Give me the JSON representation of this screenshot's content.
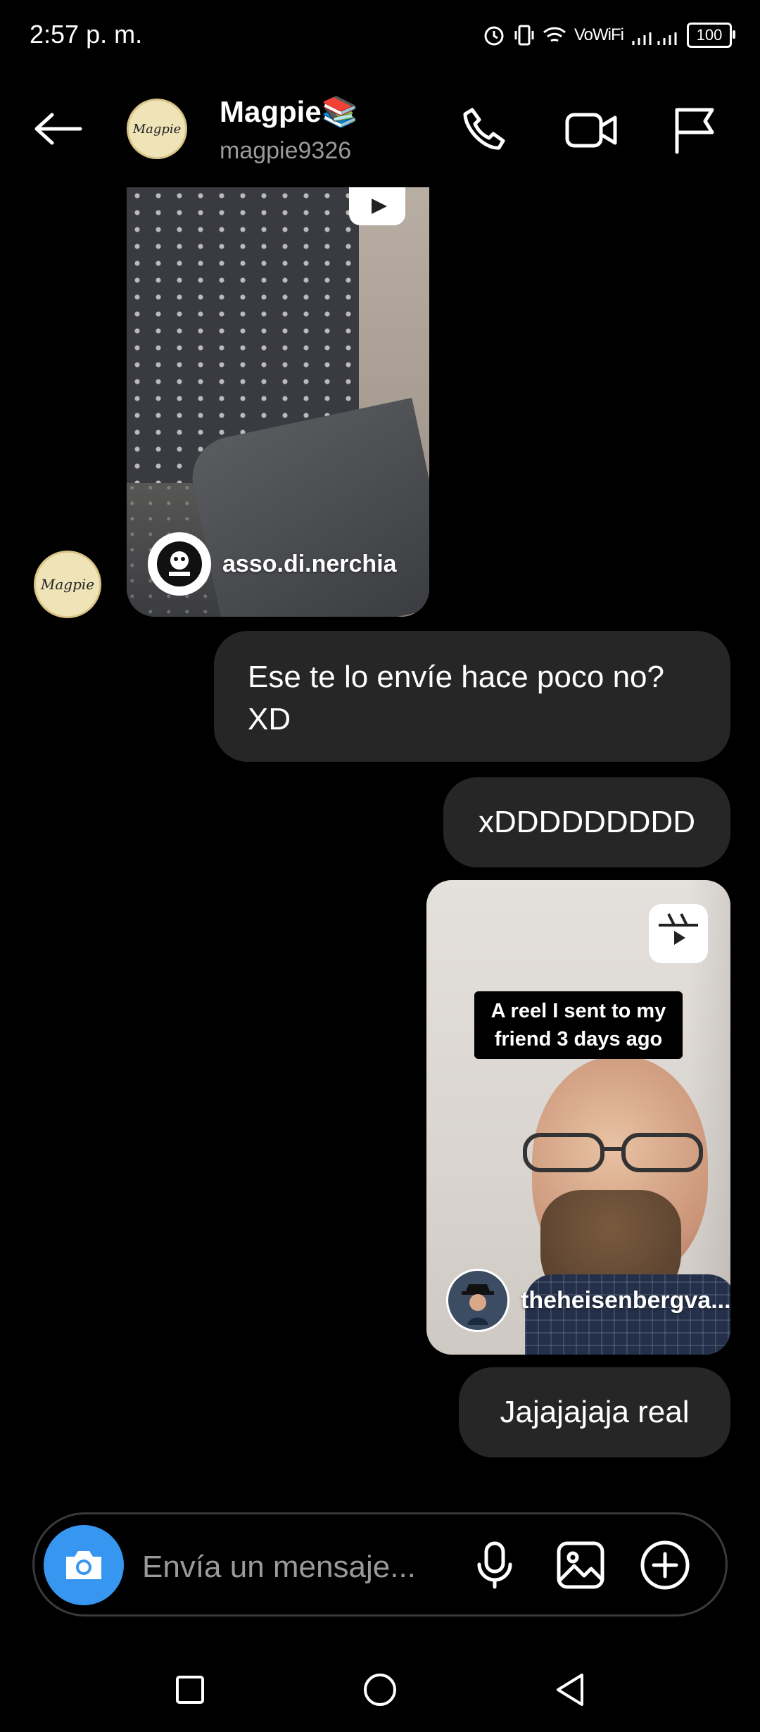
{
  "status_bar": {
    "time": "2:57 p. m.",
    "network_label": "VoWiFi",
    "battery": "100"
  },
  "header": {
    "name": "Magpie📚",
    "username": "magpie9326",
    "avatar_text": "Magpie"
  },
  "messages": [
    {
      "type": "reel",
      "side": "received",
      "author": "asso.di.nerchia"
    },
    {
      "type": "text",
      "side": "sent",
      "text": "Ese te lo envíe hace poco no? XD"
    },
    {
      "type": "text",
      "side": "sent",
      "text": "xDDDDDDDDD"
    },
    {
      "type": "reel",
      "side": "sent",
      "caption": "A reel I sent to my friend 3 days ago",
      "author": "theheisenbergva..."
    },
    {
      "type": "text",
      "side": "sent",
      "text": "Jajajajaja real"
    }
  ],
  "composer": {
    "placeholder": "Envía un mensaje..."
  },
  "colors": {
    "background": "#000000",
    "bubble": "#262626",
    "accent": "#3797f0"
  },
  "icons": {
    "back": "arrow-left-icon",
    "call": "phone-icon",
    "video": "video-camera-icon",
    "report": "flag-icon",
    "camera": "camera-icon",
    "mic": "microphone-icon",
    "gallery": "image-icon",
    "more": "plus-circle-icon",
    "reel": "reel-icon"
  }
}
